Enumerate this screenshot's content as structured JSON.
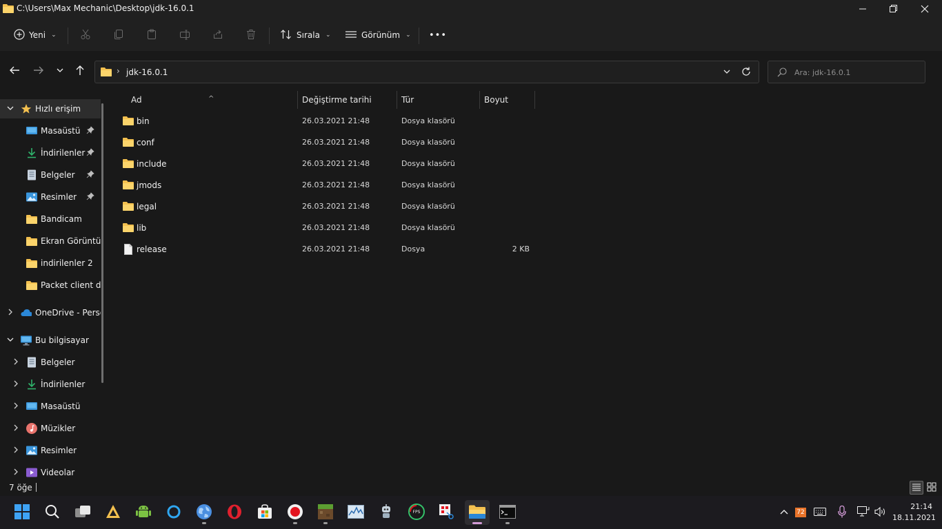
{
  "window": {
    "title": "C:\\Users\\Max Mechanic\\Desktop\\jdk-16.0.1",
    "controls": [
      "minimize-icon",
      "maximize-icon",
      "close-icon"
    ]
  },
  "toolbar": {
    "new_label": "Yeni",
    "sort_label": "Sırala",
    "view_label": "Görünüm",
    "more_label": "•••",
    "icon_buttons": [
      "cut-icon",
      "copy-icon",
      "paste-icon",
      "rename-icon",
      "share-icon",
      "delete-icon"
    ]
  },
  "navigation": {
    "path_segment": "jdk-16.0.1",
    "path_separator": "›",
    "search_placeholder": "Ara: jdk-16.0.1"
  },
  "sidebar": {
    "quick_access": {
      "label": "Hızlı erişim",
      "items": [
        {
          "label": "Masaüstü",
          "icon": "desktop-icon",
          "pinned": true
        },
        {
          "label": "İndirilenler",
          "icon": "download-icon",
          "pinned": true
        },
        {
          "label": "Belgeler",
          "icon": "documents-icon",
          "pinned": true
        },
        {
          "label": "Resimler",
          "icon": "pictures-icon",
          "pinned": true
        },
        {
          "label": "Bandicam",
          "icon": "folder-icon",
          "pinned": false
        },
        {
          "label": "Ekran Görüntül",
          "icon": "folder-icon",
          "pinned": false
        },
        {
          "label": "indirilenler 2",
          "icon": "folder-icon",
          "pinned": false
        },
        {
          "label": "Packet client  d",
          "icon": "folder-icon",
          "pinned": false
        }
      ]
    },
    "onedrive_label": "OneDrive - Perso",
    "this_pc": {
      "label": "Bu bilgisayar",
      "items": [
        {
          "label": "Belgeler",
          "icon": "documents-icon"
        },
        {
          "label": "İndirilenler",
          "icon": "download-icon"
        },
        {
          "label": "Masaüstü",
          "icon": "desktop-icon"
        },
        {
          "label": "Müzikler",
          "icon": "music-icon"
        },
        {
          "label": "Resimler",
          "icon": "pictures-icon"
        },
        {
          "label": "Videolar",
          "icon": "videos-icon"
        }
      ]
    }
  },
  "file_list": {
    "columns": {
      "name": "Ad",
      "modified": "Değiştirme tarihi",
      "type": "Tür",
      "size": "Boyut"
    },
    "rows": [
      {
        "name": "bin",
        "modified": "26.03.2021 21:48",
        "type": "Dosya klasörü",
        "size": "",
        "icon": "folder-icon"
      },
      {
        "name": "conf",
        "modified": "26.03.2021 21:48",
        "type": "Dosya klasörü",
        "size": "",
        "icon": "folder-icon"
      },
      {
        "name": "include",
        "modified": "26.03.2021 21:48",
        "type": "Dosya klasörü",
        "size": "",
        "icon": "folder-icon"
      },
      {
        "name": "jmods",
        "modified": "26.03.2021 21:48",
        "type": "Dosya klasörü",
        "size": "",
        "icon": "folder-icon"
      },
      {
        "name": "legal",
        "modified": "26.03.2021 21:48",
        "type": "Dosya klasörü",
        "size": "",
        "icon": "folder-icon"
      },
      {
        "name": "lib",
        "modified": "26.03.2021 21:48",
        "type": "Dosya klasörü",
        "size": "",
        "icon": "folder-icon"
      },
      {
        "name": "release",
        "modified": "26.03.2021 21:48",
        "type": "Dosya",
        "size": "2 KB",
        "icon": "file-icon"
      }
    ]
  },
  "status_bar": {
    "item_count": "7 öğe",
    "view_modes": [
      "details-view-icon",
      "large-icons-view-icon"
    ]
  },
  "taskbar": {
    "apps": [
      "start-icon",
      "search-icon",
      "task-view-icon",
      "archive-app-icon",
      "android-studio-icon",
      "cortana-icon",
      "browser-globe-icon",
      "opera-icon",
      "microsoft-store-icon",
      "record-app-icon",
      "minecraft-icon",
      "resource-monitor-icon",
      "robot-app-icon",
      "fps-app-icon",
      "snipping-tool-icon",
      "file-explorer-icon",
      "terminal-icon"
    ],
    "tray": [
      "chevron-up-icon",
      "temperature-badge-icon",
      "keyboard-icon",
      "microphone-icon",
      "network-icon",
      "volume-icon"
    ],
    "tray_badge": "72",
    "time": "21:14",
    "date": "18.11.2021"
  },
  "colors": {
    "background": "#191919",
    "chrome": "#202020",
    "folder": "#f3c04f",
    "accent": "#3ea3f5"
  }
}
